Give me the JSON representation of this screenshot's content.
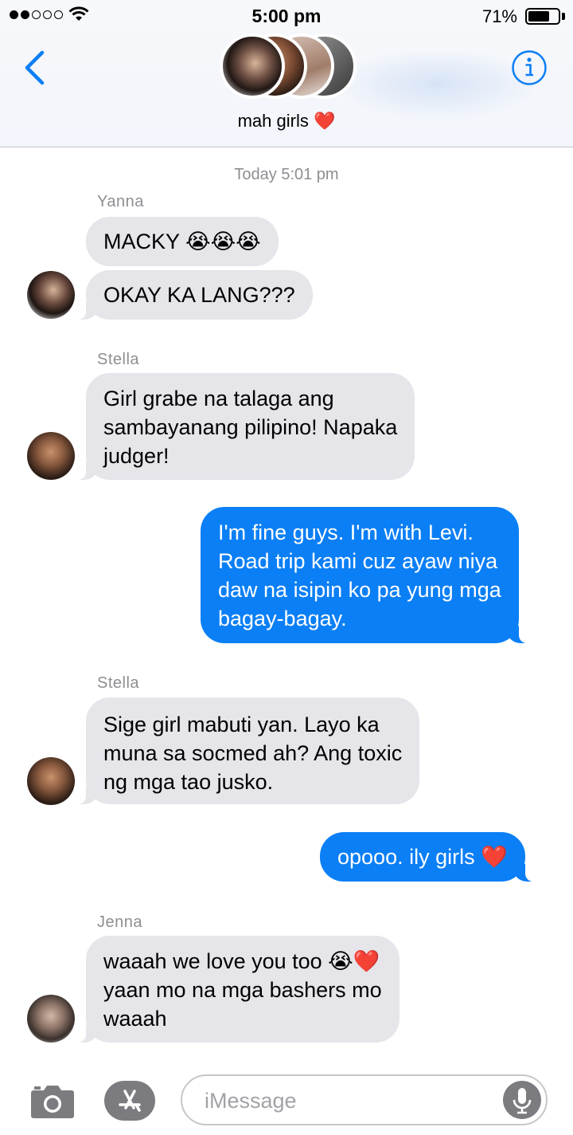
{
  "status_bar": {
    "time": "5:00 pm",
    "battery_percent_label": "71%",
    "battery_level": 0.71,
    "signal_bars_filled": 2,
    "signal_bars_total": 5
  },
  "header": {
    "group_name": "mah girls",
    "group_emoji": "❤️",
    "back_icon": "chevron-left-icon",
    "info_icon": "info-icon",
    "accent_color": "#0b7ff5"
  },
  "conversation": {
    "timestamp": "Today 5:01 pm",
    "messages": [
      {
        "sender": "Yanna",
        "direction": "incoming",
        "text": "MACKY 😭😭😭"
      },
      {
        "sender": "Yanna",
        "direction": "incoming",
        "text": "OKAY KA LANG???"
      },
      {
        "sender": "Stella",
        "direction": "incoming",
        "text": "Girl grabe na talaga ang\nsambayanang pilipino! Napaka\njudger!"
      },
      {
        "sender": "",
        "direction": "outgoing",
        "text": "I'm fine guys. I'm with Levi.\nRoad trip kami cuz ayaw niya\ndaw na isipin ko pa yung mga\nbagay-bagay."
      },
      {
        "sender": "Stella",
        "direction": "incoming",
        "text": "Sige girl mabuti yan. Layo ka\nmuna sa socmed ah? Ang toxic\nng mga tao jusko."
      },
      {
        "sender": "",
        "direction": "outgoing",
        "text": "opooo. ily girls ❤️"
      },
      {
        "sender": "Jenna",
        "direction": "incoming",
        "text": "waaah we love you too 😭❤️\nyaan mo na mga bashers mo\nwaaah"
      }
    ]
  },
  "input_bar": {
    "placeholder": "iMessage",
    "camera_icon": "camera-icon",
    "apps_icon": "app-store-icon",
    "mic_icon": "microphone-icon"
  },
  "colors": {
    "incoming_bubble": "#e5e5ea",
    "outgoing_bubble": "#0b7ff5",
    "meta_text": "#8e8e93"
  }
}
